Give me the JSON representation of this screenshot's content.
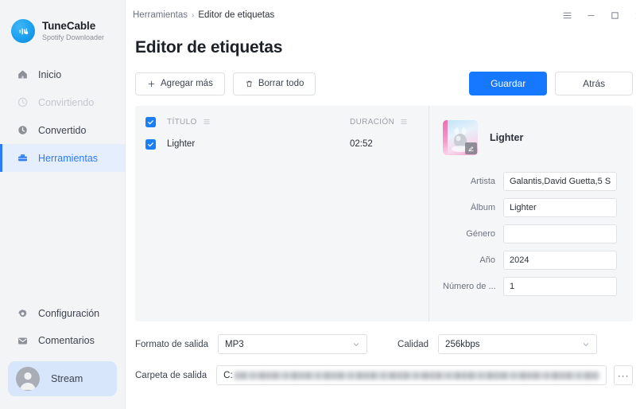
{
  "brand": {
    "name": "TuneCable",
    "subtitle": "Spotify Downloader",
    "logo_icon": "music-note-icon"
  },
  "sidebar": {
    "top_items": [
      {
        "label": "Inicio",
        "icon": "home-icon",
        "state": "normal"
      },
      {
        "label": "Convirtiendo",
        "icon": "converting-icon",
        "state": "disabled"
      },
      {
        "label": "Convertido",
        "icon": "clock-icon",
        "state": "normal"
      },
      {
        "label": "Herramientas",
        "icon": "toolbox-icon",
        "state": "active"
      }
    ],
    "bottom_items": [
      {
        "label": "Configuración",
        "icon": "gear-icon"
      },
      {
        "label": "Comentarios",
        "icon": "message-icon"
      }
    ],
    "account": {
      "label": "Stream",
      "icon": "avatar-icon"
    }
  },
  "titlebar": {
    "breadcrumb_parent": "Herramientas",
    "breadcrumb_sep": "›",
    "breadcrumb_current": "Editor de etiquetas",
    "controls": {
      "menu": "hamburger-menu-icon",
      "minimize": "minimize-icon",
      "maximize": "maximize-icon",
      "close": "close-icon"
    }
  },
  "page": {
    "title": "Editor de etiquetas"
  },
  "toolbar": {
    "add_more_label": "Agregar más",
    "add_more_icon": "plus-icon",
    "clear_all_label": "Borrar todo",
    "clear_all_icon": "trash-icon",
    "save_label": "Guardar",
    "back_label": "Atrás",
    "primary_color": "#1677ff"
  },
  "table": {
    "columns": [
      {
        "label": "TÍTULO",
        "filter_icon": "filter-icon"
      },
      {
        "label": "DURACIÓN",
        "filter_icon": "filter-icon"
      }
    ],
    "select_all_checked": true,
    "rows": [
      {
        "checked": true,
        "title": "Lighter",
        "duration": "02:52"
      }
    ]
  },
  "details": {
    "cover_icon": "album-art",
    "cover_edit_icon": "edit-pencil-icon",
    "track_title": "Lighter",
    "fields": [
      {
        "label": "Artista",
        "value": "Galantis,David Guetta,5 S"
      },
      {
        "label": "Álbum",
        "value": "Lighter"
      },
      {
        "label": "Género",
        "value": ""
      },
      {
        "label": "Año",
        "value": "2024"
      },
      {
        "label": "Número de ...",
        "value": "1"
      }
    ]
  },
  "bottom": {
    "format_label": "Formato de salida",
    "format_value": "MP3",
    "quality_label": "Calidad",
    "quality_value": "256kbps",
    "folder_label": "Carpeta de salida",
    "folder_value": "C:",
    "browse_label": "···",
    "chevron_icon": "chevron-down-icon"
  }
}
